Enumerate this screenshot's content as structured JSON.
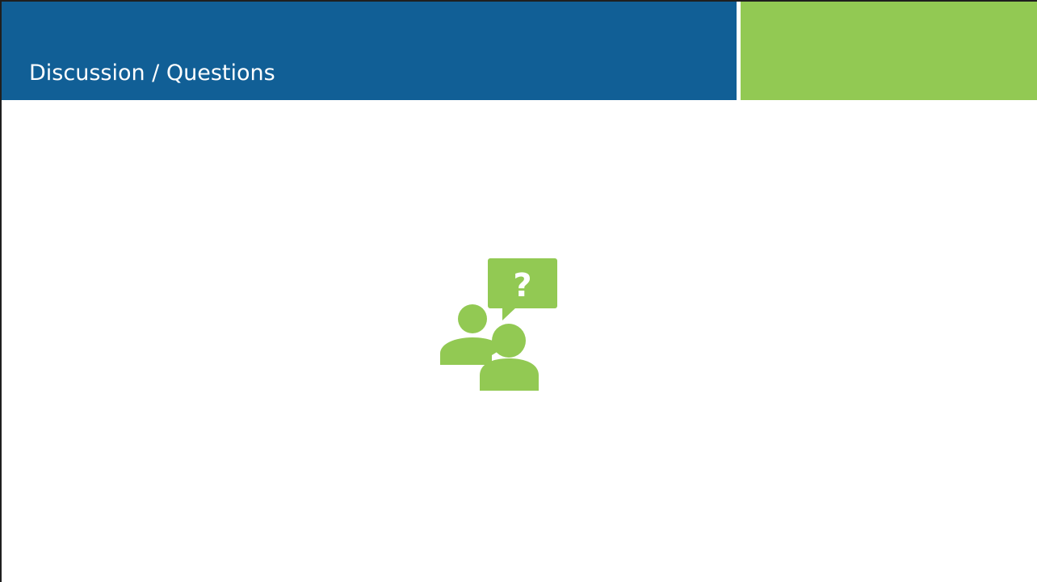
{
  "slide": {
    "title": "Discussion / Questions",
    "graphic": {
      "icon": "discussion-question-icon",
      "question_mark": "?"
    }
  },
  "colors": {
    "header_blue": "#115f96",
    "accent_green": "#92c953",
    "icon_green": "#92c953",
    "title_text": "#ffffff",
    "frame": "#1f1f1f",
    "background": "#ffffff"
  }
}
